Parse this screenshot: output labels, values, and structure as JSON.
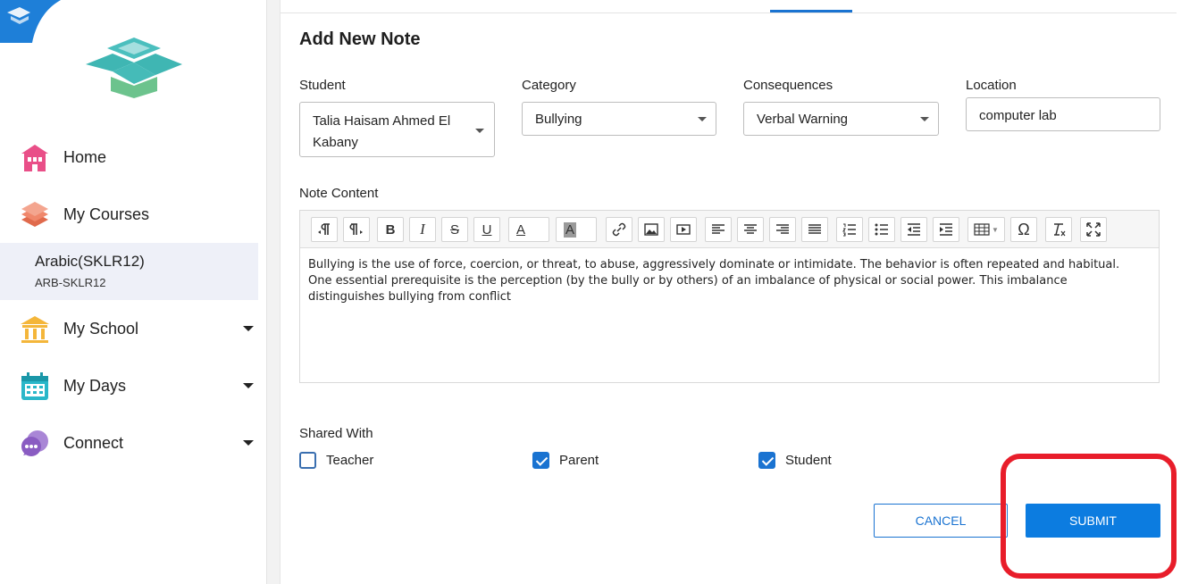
{
  "sidebar": {
    "nav": [
      {
        "label": "Home",
        "icon": "home-icon"
      },
      {
        "label": "My Courses",
        "icon": "books-icon"
      },
      {
        "label": "My School",
        "icon": "school-icon"
      },
      {
        "label": "My Days",
        "icon": "calendar-icon"
      },
      {
        "label": "Connect",
        "icon": "chat-icon"
      }
    ],
    "course": {
      "name": "Arabic(SKLR12)",
      "code": "ARB-SKLR12"
    }
  },
  "form": {
    "title": "Add New Note",
    "student": {
      "label": "Student",
      "value": "Talia Haisam Ahmed El Kabany"
    },
    "category": {
      "label": "Category",
      "value": "Bullying"
    },
    "consequences": {
      "label": "Consequences",
      "value": "Verbal Warning"
    },
    "location": {
      "label": "Location",
      "value": "computer lab"
    },
    "note_content": {
      "label": "Note Content",
      "text": "Bullying is the use of force, coercion, or threat, to abuse, aggressively dominate or intimidate. The behavior is often repeated and habitual. One essential prerequisite is the perception (by the bully or by others) of an imbalance of physical or social power. This imbalance distinguishes bullying from conflict"
    },
    "shared_with": {
      "label": "Shared With",
      "options": [
        {
          "label": "Teacher",
          "checked": false
        },
        {
          "label": "Parent",
          "checked": true
        },
        {
          "label": "Student",
          "checked": true
        }
      ]
    },
    "cancel_label": "CANCEL",
    "submit_label": "SUBMIT"
  },
  "toolbar": {
    "bold": "B",
    "italic": "I",
    "strike": "S",
    "underline": "U",
    "font_color": "A",
    "bg_color": "A",
    "special_char": "Ω"
  },
  "colors": {
    "accent": "#1a73d1",
    "submit": "#0c7ce0",
    "highlight": "#e81d2a"
  }
}
